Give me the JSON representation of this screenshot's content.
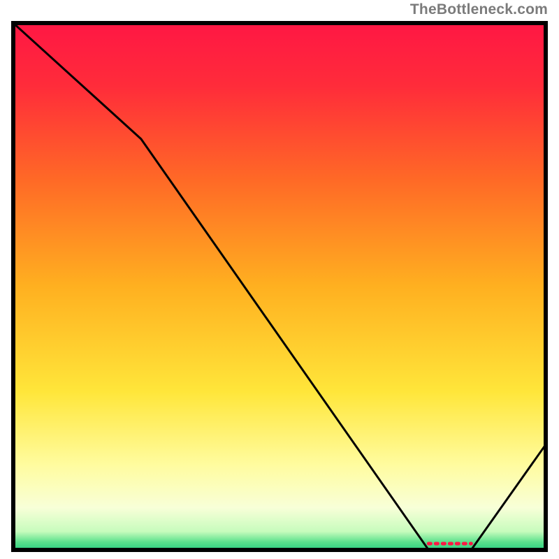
{
  "attribution": "TheBottleneck.com",
  "chart_data": {
    "type": "line",
    "title": "",
    "xlabel": "",
    "ylabel": "",
    "xlim": [
      0,
      100
    ],
    "ylim": [
      0,
      100
    ],
    "x": [
      0,
      24,
      78,
      86,
      100
    ],
    "values": [
      100,
      78,
      0,
      0,
      20
    ],
    "gradient_stops": [
      {
        "offset": 0.0,
        "color": "#ff1744"
      },
      {
        "offset": 0.12,
        "color": "#ff2c3a"
      },
      {
        "offset": 0.3,
        "color": "#ff6a26"
      },
      {
        "offset": 0.5,
        "color": "#ffb020"
      },
      {
        "offset": 0.7,
        "color": "#ffe63a"
      },
      {
        "offset": 0.84,
        "color": "#fffca0"
      },
      {
        "offset": 0.92,
        "color": "#f8ffd8"
      },
      {
        "offset": 0.965,
        "color": "#c7fcbd"
      },
      {
        "offset": 0.985,
        "color": "#5be08c"
      },
      {
        "offset": 1.0,
        "color": "#2ecf80"
      }
    ],
    "dashed_segment": {
      "x0": 78,
      "x1": 86,
      "y": 1.2,
      "color": "#ff1744"
    },
    "border_color": "#000000",
    "border_width": 6,
    "curve_color": "#000000",
    "curve_width": 3
  }
}
